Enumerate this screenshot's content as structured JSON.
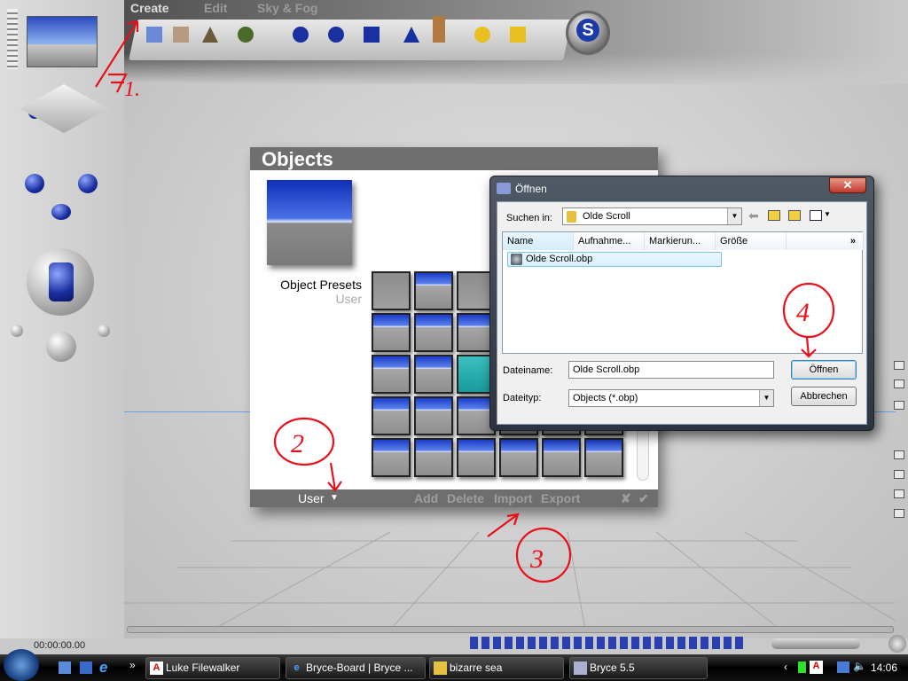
{
  "menu": {
    "create": "Create",
    "edit": "Edit",
    "sky_fog": "Sky & Fog"
  },
  "objects_panel": {
    "title": "Objects",
    "preset_category": "Object Presets",
    "preset_subcategory": "User",
    "footer": {
      "category": "User",
      "add": "Add",
      "delete": "Delete",
      "import": "Import",
      "export": "Export",
      "cancel": "✘",
      "ok": "✔"
    }
  },
  "dialog": {
    "title": "Öffnen",
    "close": "✕",
    "look_in_label": "Suchen in:",
    "look_in_value": "Olde Scroll",
    "columns": [
      "Name",
      "Aufnahme...",
      "Markierun...",
      "Größe"
    ],
    "more_columns": "»",
    "files": [
      "Olde Scroll.obp"
    ],
    "filename_label": "Dateiname:",
    "filename_value": "Olde Scroll.obp",
    "filetype_label": "Dateityp:",
    "filetype_value": "Objects (*.obp)",
    "open_button": "Öffnen",
    "cancel_button": "Abbrechen"
  },
  "time_display": "00:00:00.00",
  "annotations": [
    "1.",
    "2",
    "3",
    "4"
  ],
  "taskbar": {
    "tasks": [
      {
        "label": "Luke Filewalker",
        "icon": "avira-icon"
      },
      {
        "label": "Bryce-Board | Bryce ...",
        "icon": "ie-icon"
      },
      {
        "label": "bizarre sea",
        "icon": "folder-icon"
      },
      {
        "label": "Bryce 5.5",
        "icon": "bryce-icon"
      }
    ],
    "clock": "14:06",
    "overflow": "»"
  },
  "colors": {
    "annotation": "#e8101a",
    "panel_header": "#6f6f6f",
    "selection": "#d9f0fc"
  }
}
